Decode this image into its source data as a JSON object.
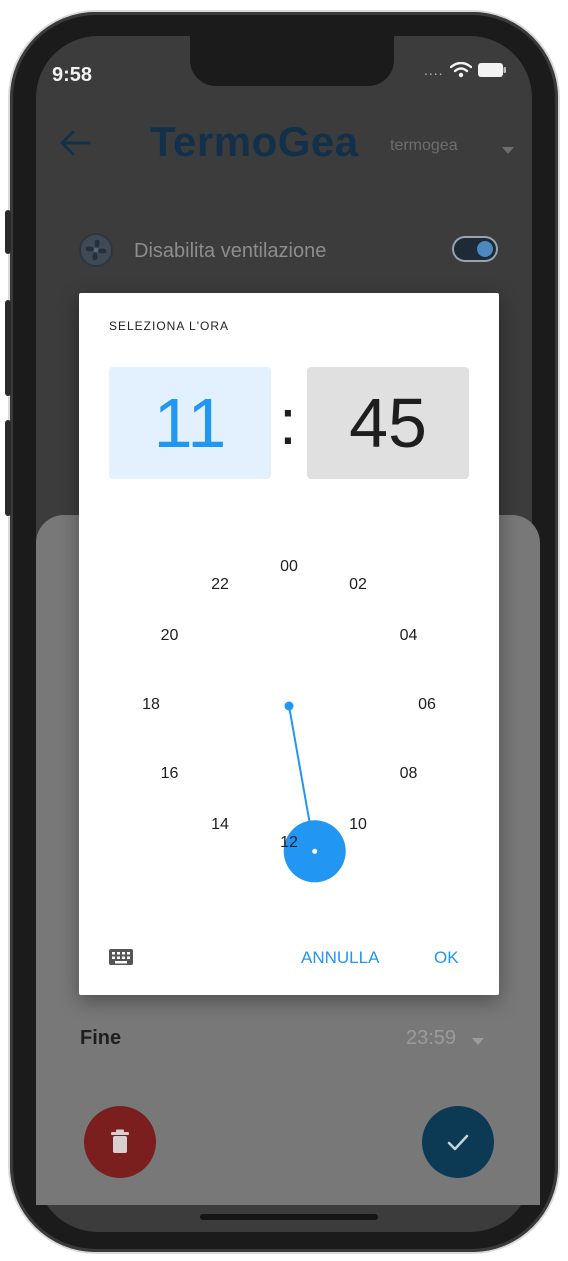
{
  "status_bar": {
    "time": "9:58",
    "signal": "....",
    "wifi_icon": "wifi-icon",
    "battery_icon": "battery-icon"
  },
  "app_bar": {
    "back_icon": "back-arrow-icon",
    "logo": "TermoGea",
    "account": "termogea",
    "account_caret_icon": "dropdown-caret-icon"
  },
  "ventilation": {
    "icon": "fan-icon",
    "label": "Disabilita ventilazione",
    "enabled": true
  },
  "dialog": {
    "title": "SELEZIONA L'ORA",
    "hour": "11",
    "separator": ":",
    "minute": "45",
    "selected_hour_value": 11,
    "clock_numbers": [
      "00",
      "02",
      "04",
      "06",
      "08",
      "10",
      "12",
      "14",
      "16",
      "18",
      "20",
      "22"
    ],
    "keyboard_icon": "keyboard-icon",
    "cancel_label": "ANNULLA",
    "ok_label": "OK"
  },
  "end_time": {
    "label": "Fine",
    "value": "23:59",
    "caret_icon": "dropdown-caret-icon"
  },
  "actions": {
    "delete_icon": "trash-icon",
    "confirm_icon": "checkmark-icon"
  },
  "colors": {
    "accent": "#2196f3",
    "selected_hour_bg": "#e3f0fd",
    "minute_bg": "#e0e0e0",
    "logo": "#12304a",
    "delete_fab": "#7a1e1e",
    "confirm_fab": "#0c3a55"
  }
}
